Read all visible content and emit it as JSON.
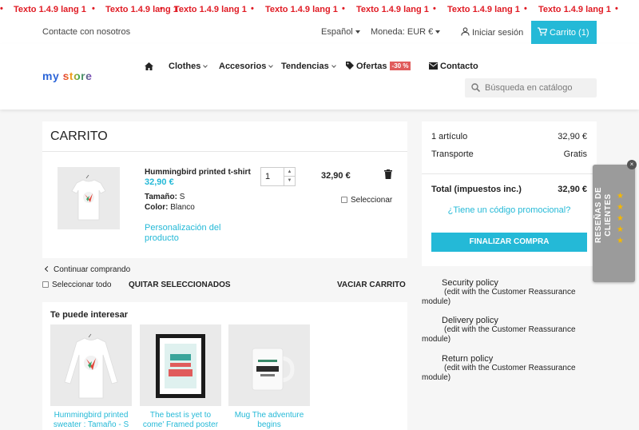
{
  "marquee": {
    "text": "Texto 1.4.9 lang 1",
    "dot": "•"
  },
  "topnav": {
    "contact": "Contacte con nosotros",
    "language": "Español",
    "currency": "Moneda: EUR €",
    "login": "Iniciar sesión",
    "cart": "Carrito (1)"
  },
  "header": {
    "logo": "my store",
    "menu": [
      "Clothes",
      "Accesorios",
      "Tendencias",
      "Ofertas",
      "Contacto"
    ],
    "offer_badge": "-30 %",
    "search_placeholder": "Búsqueda en catálogo"
  },
  "cart": {
    "title": "CARRITO",
    "item": {
      "name": "Hummingbird printed t-shirt",
      "price": "32,90 €",
      "size_label": "Tamaño:",
      "size_value": "S",
      "color_label": "Color:",
      "color_value": "Blanco",
      "customize_1": "Personalización del",
      "customize_2": "producto",
      "quantity": "1",
      "line_total": "32,90 €",
      "select": "Seleccionar"
    },
    "continue": "Continuar comprando",
    "select_all": "Seleccionar todo",
    "remove_selected": "QUITAR SELECCIONADOS",
    "empty_cart": "VACIAR CARRITO"
  },
  "suggestions": {
    "title": "Te puede interesar",
    "products": [
      {
        "line1": "Hummingbird printed",
        "line2": "sweater : Tamaño - S"
      },
      {
        "line1": "The best is yet to",
        "line2": "come' Framed poster ..."
      },
      {
        "line1": "Mug The adventure",
        "line2": "begins"
      }
    ]
  },
  "summary": {
    "items_label": "1 artículo",
    "items_value": "32,90 €",
    "shipping_label": "Transporte",
    "shipping_value": "Gratis",
    "total_label": "Total (impuestos inc.)",
    "total_value": "32,90 €",
    "promo": "¿Tiene un código promocional?",
    "checkout": "FINALIZAR COMPRA"
  },
  "reassurance": [
    {
      "title": "Security policy",
      "desc1": "(edit with the Customer Reassurance",
      "desc2": "module)"
    },
    {
      "title": "Delivery policy",
      "desc1": "(edit with the Customer Reassurance",
      "desc2": "module)"
    },
    {
      "title": "Return policy",
      "desc1": "(edit with the Customer Reassurance",
      "desc2": "module)"
    }
  ],
  "reviews_widget": {
    "line1": "RESEÑAS DE",
    "line2": "CLIENTES",
    "close": "×",
    "star": "★"
  },
  "colors": {
    "accent": "#24b9d7",
    "marquee_red": "#e01b24",
    "badge": "#e05c5c"
  }
}
